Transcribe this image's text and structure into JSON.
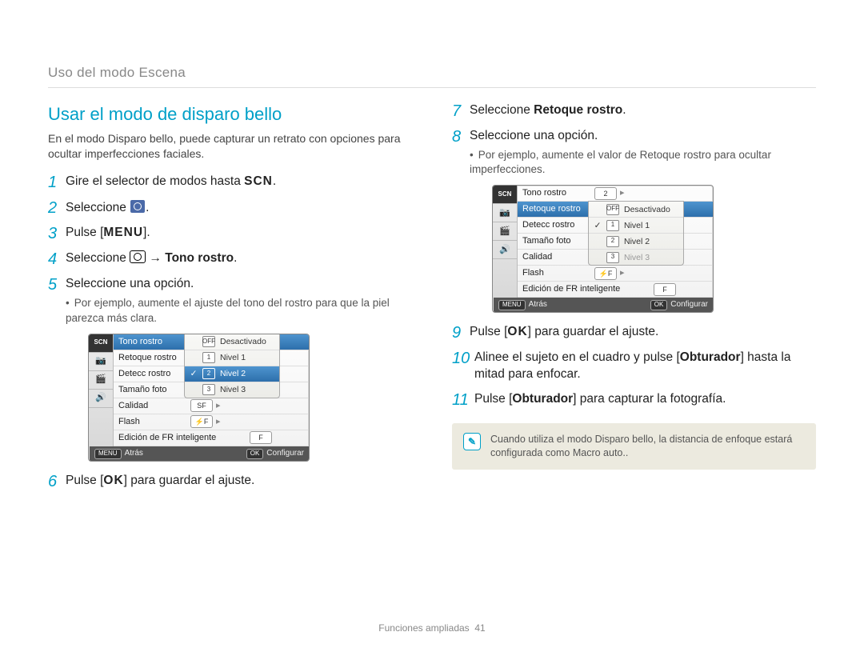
{
  "breadcrumb": "Uso del modo Escena",
  "section_title": "Usar el modo de disparo bello",
  "intro": "En el modo Disparo bello, puede capturar un retrato con opciones para ocultar imperfecciones faciales.",
  "glyphs": {
    "scn": "SCN",
    "menu": "MENU",
    "ok": "OK",
    "arrow": "→"
  },
  "left_steps": {
    "s1": {
      "num": "1",
      "t_a": "Gire el selector de modos hasta ",
      "t_b": "."
    },
    "s2": {
      "num": "2",
      "t_a": "Seleccione ",
      "t_b": "."
    },
    "s3": {
      "num": "3",
      "t_a": "Pulse [",
      "t_b": "]."
    },
    "s4": {
      "num": "4",
      "t_a": "Seleccione ",
      "t_mid": " ",
      "t_bold": "Tono rostro",
      "t_b": "."
    },
    "s5": {
      "num": "5",
      "t": "Seleccione una opción.",
      "sub": "Por ejemplo, aumente el ajuste del tono del rostro para que la piel parezca más clara."
    },
    "s6": {
      "num": "6",
      "t_a": "Pulse [",
      "t_b": "] para guardar el ajuste."
    }
  },
  "right_steps": {
    "s7": {
      "num": "7",
      "t_a": "Seleccione ",
      "t_bold": "Retoque rostro",
      "t_b": "."
    },
    "s8": {
      "num": "8",
      "t": "Seleccione una opción.",
      "sub": "Por ejemplo, aumente el valor de Retoque rostro para ocultar imperfecciones."
    },
    "s9": {
      "num": "9",
      "t_a": "Pulse [",
      "t_b": "] para guardar el ajuste."
    },
    "s10": {
      "num": "10",
      "t_a": "Alinee el sujeto en el cuadro y pulse [",
      "t_bold": "Obturador",
      "t_mid": "] hasta la mitad para enfocar."
    },
    "s11": {
      "num": "11",
      "t_a": "Pulse [",
      "t_bold": "Obturador",
      "t_b": "] para capturar la fotografía."
    }
  },
  "lcd_common": {
    "tabs": {
      "scn": "SCN",
      "cam": "📷",
      "vid": "🎬",
      "snd": "🔊"
    },
    "menu_items": {
      "tono": "Tono rostro",
      "retoque": "Retoque rostro",
      "detecc": "Detecc rostro",
      "tamano": "Tamaño foto",
      "calidad": "Calidad",
      "flash": "Flash",
      "efr": "Edición de FR inteligente"
    },
    "pills": {
      "face2": "2",
      "facef": "F",
      "video": "▸",
      "sf": "SF",
      "flashoff": "⚡F",
      "efr": "F"
    },
    "footer": {
      "back_key": "MENU",
      "back": "Atrás",
      "set_key": "OK",
      "set": "Configurar"
    }
  },
  "lcd1_options": {
    "off": {
      "ico": "OFF",
      "label": "Desactivado"
    },
    "n1": {
      "ico": "1",
      "label": "Nivel 1"
    },
    "n2": {
      "ico": "2",
      "label": "Nivel 2"
    },
    "n3": {
      "ico": "3",
      "label": "Nivel 3"
    }
  },
  "lcd2_options": {
    "off": {
      "ico": "OFF",
      "label": "Desactivado"
    },
    "n1": {
      "ico": "1",
      "label": "Nivel 1"
    },
    "n2": {
      "ico": "2",
      "label": "Nivel 2"
    },
    "n3": {
      "ico": "3",
      "label": "Nivel 3"
    }
  },
  "note": "Cuando utiliza el modo Disparo bello, la distancia de enfoque estará configurada como Macro auto..",
  "footer": {
    "label": "Funciones ampliadas",
    "page": "41"
  }
}
